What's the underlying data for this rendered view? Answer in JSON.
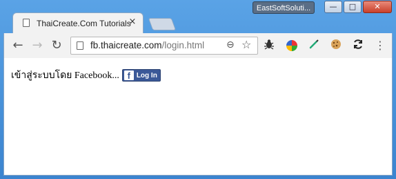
{
  "window": {
    "extension_label": "EastSoftSoluti...",
    "controls": {
      "minimize": "—",
      "maximize": "□",
      "close": "✕"
    }
  },
  "tab": {
    "title": "ThaiCreate.Com Tutorials",
    "close_glyph": "×"
  },
  "toolbar": {
    "back_glyph": "←",
    "forward_glyph": "→",
    "reload_glyph": "↻",
    "url_host": "fb.thaicreate.com",
    "url_path": "/login.html",
    "zoom_glyph": "⊖",
    "star_glyph": "☆",
    "menu_glyph": "⋮",
    "extensions": [
      "bug-icon",
      "color-wheel-icon",
      "pencil-icon",
      "cookie-icon",
      "sync-icon"
    ]
  },
  "content": {
    "login_text": "เข้าสู่ระบบโดย Facebook...",
    "fb_button": {
      "logo": "f",
      "label": "Log In",
      "color": "#3b5998"
    }
  }
}
